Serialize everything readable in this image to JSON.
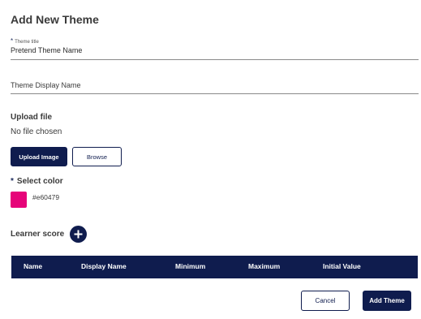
{
  "page_title": "Add New Theme",
  "theme_title": {
    "required_mark": "*",
    "label": "Theme title",
    "value": "Pretend Theme Name"
  },
  "display_name": {
    "placeholder": "Theme Display Name"
  },
  "upload": {
    "label": "Upload file",
    "status": "No file chosen",
    "upload_button": "Upload Image",
    "browse_button": "Browse"
  },
  "color": {
    "required_mark": "*",
    "label": "Select color",
    "hex": "#e60479",
    "swatch_color": "#e60479"
  },
  "learner_score": {
    "label": "Learner score",
    "add_icon": "plus-icon"
  },
  "table": {
    "columns": [
      "Name",
      "Display Name",
      "Minimum",
      "Maximum",
      "Initial Value"
    ]
  },
  "footer": {
    "cancel_label": "Cancel",
    "add_label": "Add Theme"
  },
  "colors": {
    "primary": "#0f1c4e",
    "accent": "#e60479"
  }
}
